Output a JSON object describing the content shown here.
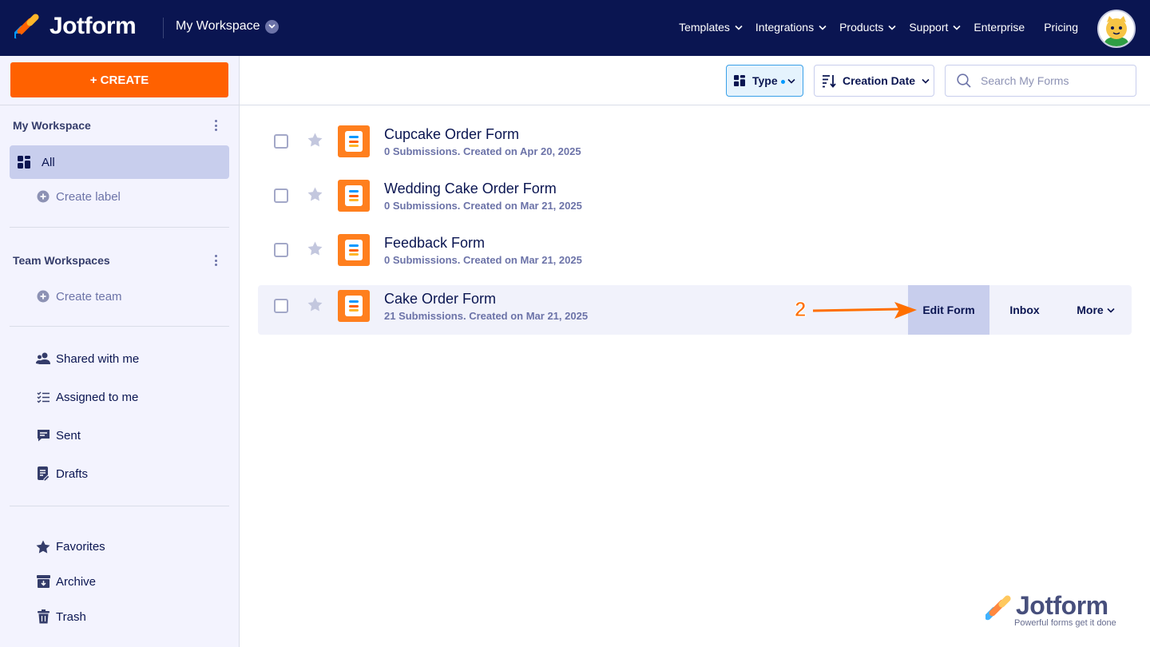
{
  "header": {
    "brand": "Jotform",
    "workspace": "My Workspace",
    "nav": [
      "Templates",
      "Integrations",
      "Products",
      "Support",
      "Enterprise",
      "Pricing"
    ],
    "nav_has_dropdown": [
      true,
      true,
      true,
      true,
      false,
      false
    ]
  },
  "sidebar": {
    "create_label": "+ CREATE",
    "my_workspace_title": "My Workspace",
    "all_label": "All",
    "create_label_link": "Create label",
    "team_workspaces_title": "Team Workspaces",
    "create_team_link": "Create team",
    "items": [
      {
        "label": "Shared with me",
        "icon": "users-icon"
      },
      {
        "label": "Assigned to me",
        "icon": "checklist-icon"
      },
      {
        "label": "Sent",
        "icon": "message-icon"
      },
      {
        "label": "Drafts",
        "icon": "draft-icon"
      }
    ],
    "bottom_items": [
      {
        "label": "Favorites",
        "icon": "star-icon"
      },
      {
        "label": "Archive",
        "icon": "archive-icon"
      },
      {
        "label": "Trash",
        "icon": "trash-icon"
      }
    ]
  },
  "toolbar": {
    "type_label": "Type",
    "sort_label": "Creation Date",
    "search_placeholder": "Search My Forms"
  },
  "forms": [
    {
      "title": "Cupcake Order Form",
      "meta": "0 Submissions. Created on Apr 20, 2025"
    },
    {
      "title": "Wedding Cake Order Form",
      "meta": "0 Submissions. Created on Mar 21, 2025"
    },
    {
      "title": "Feedback Form",
      "meta": "0 Submissions. Created on Mar 21, 2025"
    },
    {
      "title": "Cake Order Form",
      "meta": "21 Submissions. Created on Mar 21, 2025"
    }
  ],
  "row_actions": {
    "edit": "Edit Form",
    "inbox": "Inbox",
    "more": "More"
  },
  "annotation": {
    "step": "2",
    "color": "#ff6f00"
  },
  "watermark": {
    "brand": "Jotform",
    "tagline": "Powerful forms get it done"
  },
  "colors": {
    "navy": "#0a1551",
    "orange": "#ff6100",
    "sidebar_bg": "#f3f3fe",
    "active_bg": "#c8ceed"
  }
}
